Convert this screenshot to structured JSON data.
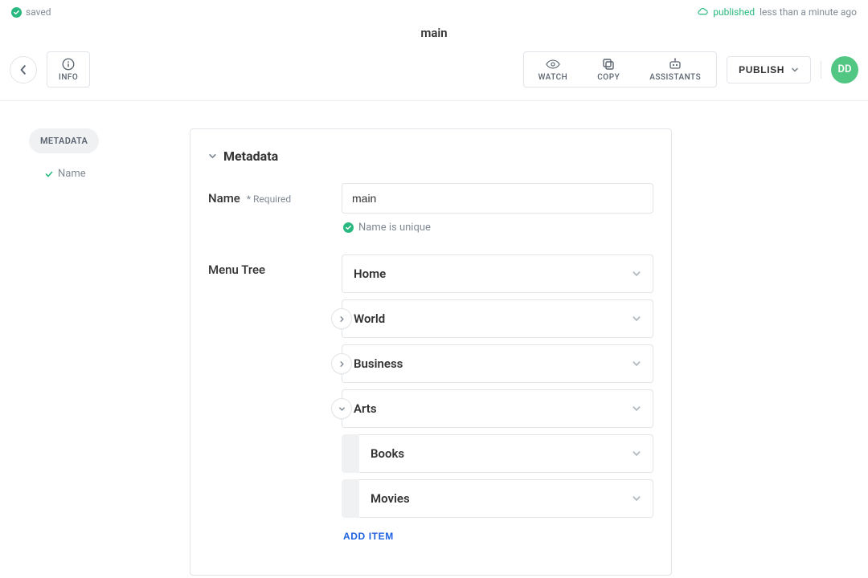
{
  "status": {
    "saved_label": "saved",
    "published_label": "published",
    "time_ago": "less than a minute ago"
  },
  "doc_title": "main",
  "toolbar": {
    "info_label": "INFO",
    "watch_label": "WATCH",
    "copy_label": "COPY",
    "assistants_label": "ASSISTANTS",
    "publish_label": "PUBLISH",
    "avatar_initials": "DD"
  },
  "sidebar": {
    "chip_label": "METADATA",
    "sub_label": "Name"
  },
  "card": {
    "heading": "Metadata",
    "fields": {
      "name": {
        "label": "Name",
        "required_label": "* Required",
        "value": "main",
        "hint": "Name is unique"
      },
      "menu_tree": {
        "label": "Menu Tree",
        "items": [
          {
            "label": "Home",
            "expandable": false
          },
          {
            "label": "World",
            "expandable": true,
            "expanded": false
          },
          {
            "label": "Business",
            "expandable": true,
            "expanded": false
          },
          {
            "label": "Arts",
            "expandable": true,
            "expanded": true,
            "children": [
              {
                "label": "Books"
              },
              {
                "label": "Movies"
              }
            ]
          }
        ],
        "add_item_label": "ADD ITEM"
      }
    }
  }
}
